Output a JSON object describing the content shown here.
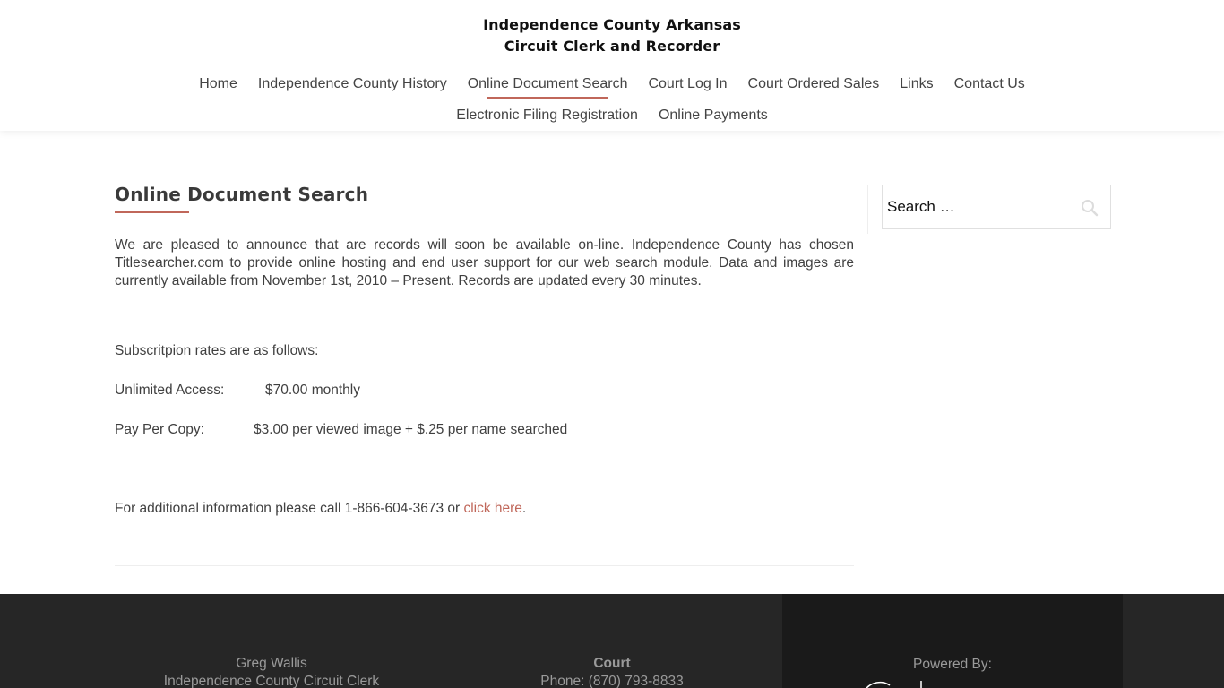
{
  "header": {
    "title_line1": "Independence County Arkansas",
    "title_line2": "Circuit Clerk and Recorder"
  },
  "nav": {
    "row1": [
      {
        "label": "Home",
        "active": false
      },
      {
        "label": "Independence County History",
        "active": false
      },
      {
        "label": "Online Document Search",
        "active": true
      },
      {
        "label": "Court Log In",
        "active": false
      },
      {
        "label": "Court Ordered Sales",
        "active": false
      },
      {
        "label": "Links",
        "active": false
      },
      {
        "label": "Contact Us",
        "active": false
      }
    ],
    "row2": [
      {
        "label": "Electronic Filing Registration",
        "active": false
      },
      {
        "label": "Online Payments",
        "active": false
      }
    ]
  },
  "main": {
    "title": "Online Document Search",
    "intro": "We are pleased to announce that are records will soon be available on-line.  Independence County has chosen Titlesearcher.com to provide online hosting and end user support for our web search module.  Data and images are currently available from November 1st, 2010 – Present.  Records are updated every 30 minutes.",
    "rates_heading": "Subscritpion rates are as follows:",
    "unlimited_label": "Unlimited Access:",
    "unlimited_value": "$70.00 monthly",
    "perpage_label": "Pay Per Copy:",
    "perpage_value": "$3.00 per viewed image + $.25 per name searched",
    "info_prefix": "For additional information please call 1-866-604-3673 or ",
    "info_link": "click here",
    "info_suffix": "."
  },
  "sidebar": {
    "search_placeholder": "Search …",
    "search_icon": "search-icon"
  },
  "footer": {
    "col1_line1": "Greg Wallis",
    "col1_line2": "Independence County Circuit Clerk",
    "col2_heading": "Court",
    "col2_line1": "Phone: (870) 793-8833",
    "col3_heading": "Powered By:"
  },
  "colors": {
    "accent": "#c0675a",
    "footer_bg": "#262626",
    "footer_dark": "#1a1a1a",
    "text": "#404040"
  }
}
